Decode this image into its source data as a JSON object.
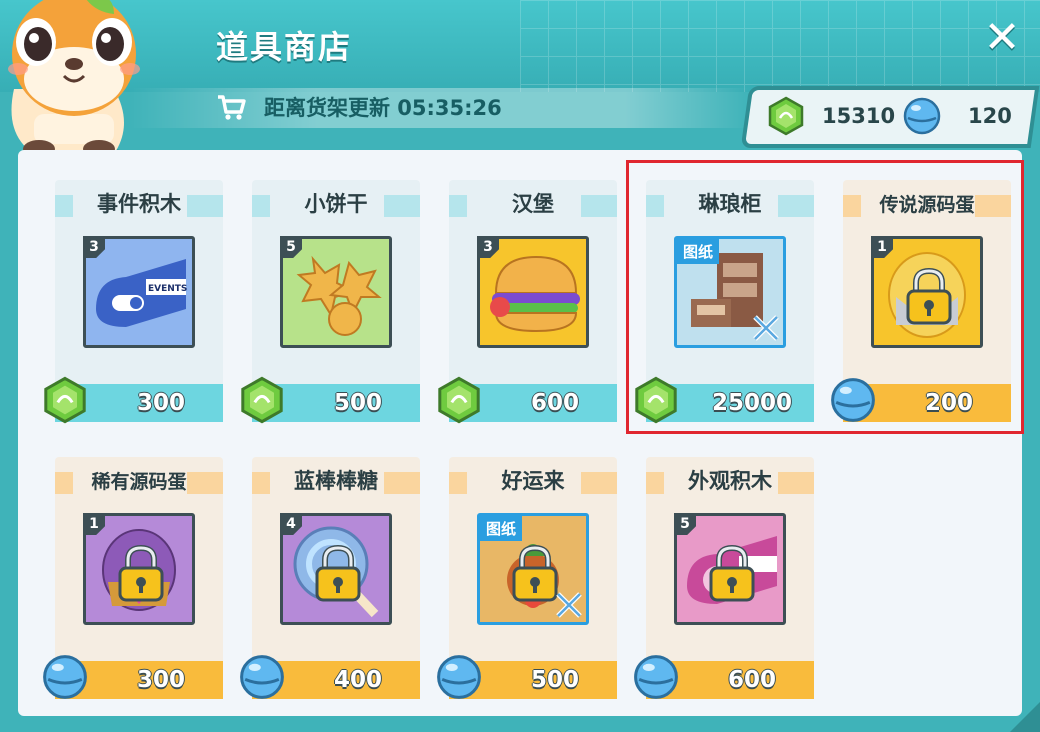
{
  "window": {
    "title": "道具商店",
    "close_label": "✕",
    "refresh_text": "距离货架更新 05:35:26"
  },
  "currency": {
    "green_gem": "15310",
    "blue_ball": "120"
  },
  "items": [
    {
      "name": "事件积木",
      "qty": "3",
      "price": "300",
      "currency": "green-gem",
      "theme": "teal",
      "tag": "",
      "locked": false
    },
    {
      "name": "小饼干",
      "qty": "5",
      "price": "500",
      "currency": "green-gem",
      "theme": "teal",
      "tag": "",
      "locked": false
    },
    {
      "name": "汉堡",
      "qty": "3",
      "price": "600",
      "currency": "green-gem",
      "theme": "teal",
      "tag": "",
      "locked": false
    },
    {
      "name": "琳琅柜",
      "qty": "",
      "price": "25000",
      "currency": "green-gem",
      "theme": "teal",
      "tag": "图纸",
      "locked": false
    },
    {
      "name": "传说源码蛋",
      "qty": "1",
      "price": "200",
      "currency": "blue-ball",
      "theme": "orange",
      "tag": "",
      "locked": true
    },
    {
      "name": "稀有源码蛋",
      "qty": "1",
      "price": "300",
      "currency": "blue-ball",
      "theme": "orange",
      "tag": "",
      "locked": true
    },
    {
      "name": "蓝棒棒糖",
      "qty": "4",
      "price": "400",
      "currency": "blue-ball",
      "theme": "orange",
      "tag": "",
      "locked": true
    },
    {
      "name": "好运来",
      "qty": "",
      "price": "500",
      "currency": "blue-ball",
      "theme": "orange",
      "tag": "图纸",
      "locked": true
    },
    {
      "name": "外观积木",
      "qty": "5",
      "price": "600",
      "currency": "blue-ball",
      "theme": "orange",
      "tag": "",
      "locked": true
    }
  ],
  "colors": {
    "header": "#3fb3b9",
    "highlight": "#e0262f",
    "teal_bar": "#6dd6e0",
    "orange_bar": "#f9bb3c"
  }
}
